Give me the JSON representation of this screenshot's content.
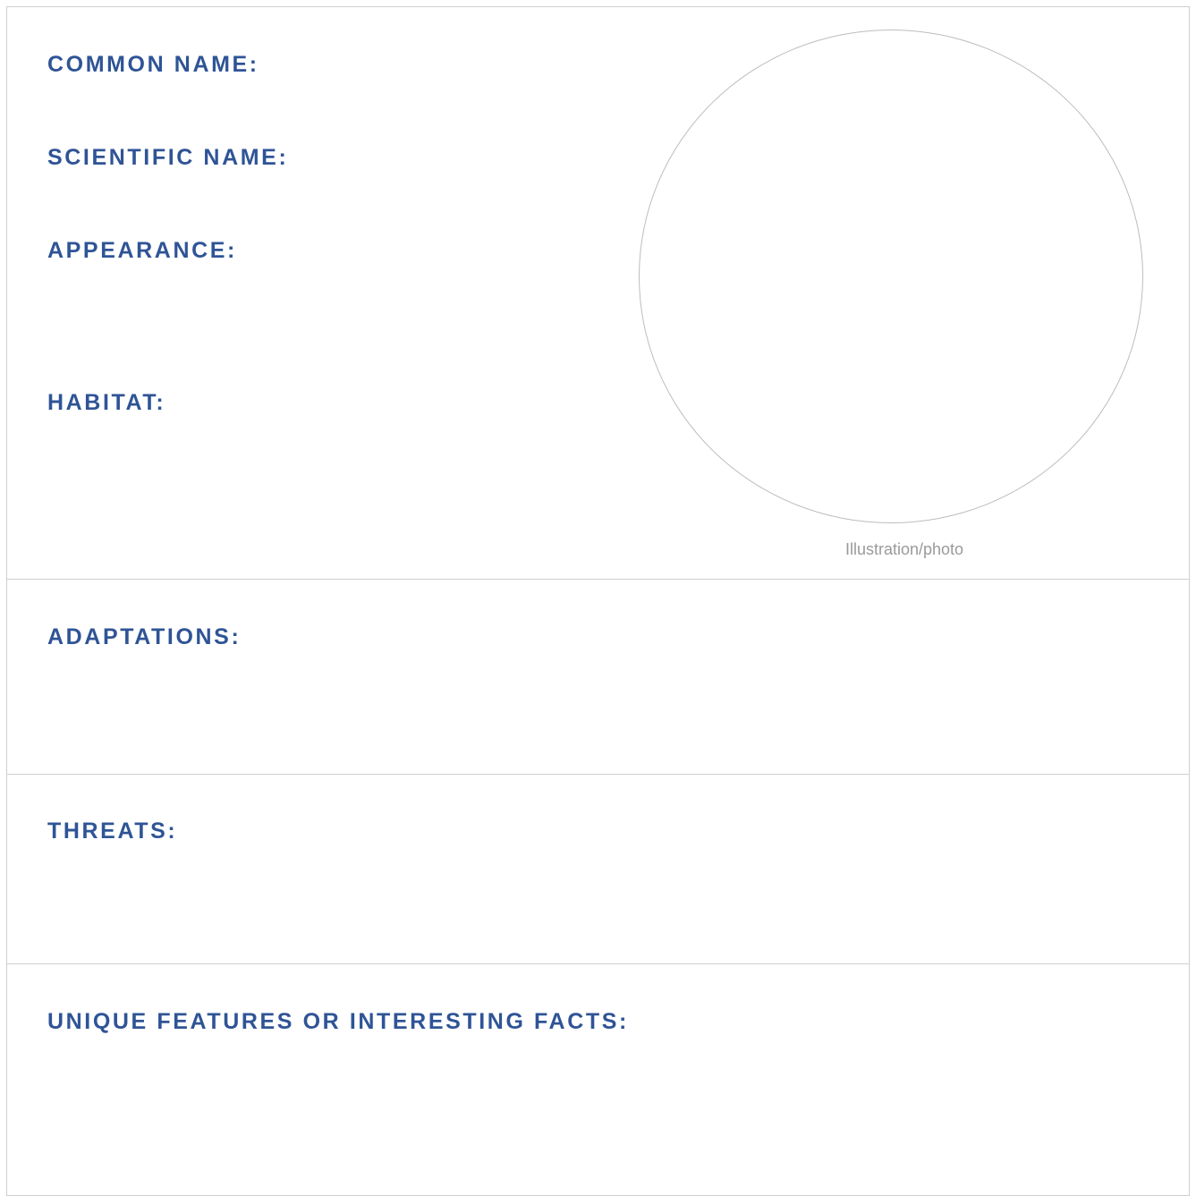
{
  "fields": {
    "common_name": "COMMON NAME:",
    "scientific_name": "SCIENTIFIC NAME:",
    "appearance": "APPEARANCE:",
    "habitat": "HABITAT:",
    "adaptations": "ADAPTATIONS:",
    "threats": "THREATS:",
    "unique_features": "UNIQUE FEATURES OR INTERESTING FACTS:"
  },
  "photo": {
    "caption": "Illustration/photo"
  },
  "colors": {
    "label": "#2f5496",
    "border": "#cfcfcf",
    "caption": "#9a9a9a"
  }
}
